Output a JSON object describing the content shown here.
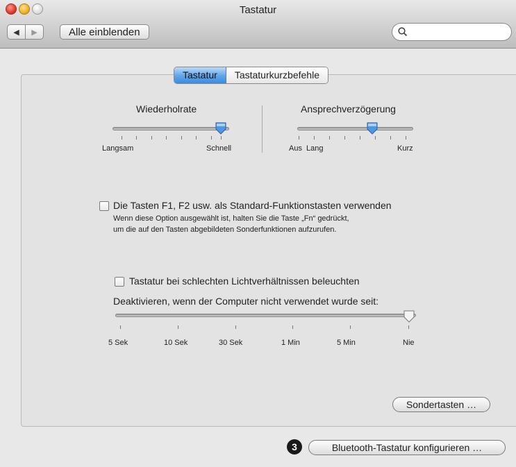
{
  "window": {
    "title": "Tastatur"
  },
  "toolbar": {
    "back_label": "◀",
    "forward_label": "▶",
    "show_all_label": "Alle einblenden",
    "search_value": "",
    "search_placeholder": ""
  },
  "tabs": [
    {
      "label": "Tastatur",
      "active": true
    },
    {
      "label": "Tastaturkurzbefehle",
      "active": false
    }
  ],
  "repeat_rate": {
    "title": "Wiederholrate",
    "min_label": "Langsam",
    "max_label": "Schnell",
    "level": 1.0
  },
  "delay": {
    "title": "Ansprechverzögerung",
    "left_label1": "Aus",
    "left_label2": "Lang",
    "right_label": "Kurz",
    "level": 0.6
  },
  "fn_keys": {
    "checked": false,
    "label": "Die Tasten F1, F2 usw. als Standard-Funktionstasten verwenden",
    "hint_line1": "Wenn diese Option ausgewählt ist, halten Sie die Taste „Fn“ gedrückt,",
    "hint_line2": "um die auf den Tasten abgebildeten Sonderfunktionen aufzurufen."
  },
  "backlight": {
    "checked": false,
    "label": "Tastatur bei schlechten Lichtverhältnissen beleuchten",
    "deactivate_label": "Deaktivieren, wenn der Computer nicht verwendet wurde seit:",
    "ticks": [
      "5 Sek",
      "10 Sek",
      "30 Sek",
      "1 Min",
      "5 Min",
      "Nie"
    ],
    "selected": "Nie"
  },
  "buttons": {
    "modifier_keys": "Sondertasten …",
    "bluetooth": "Bluetooth-Tastatur konfigurieren …"
  },
  "annotation_badge": "3",
  "colors": {
    "accent": "#3d8be0"
  }
}
